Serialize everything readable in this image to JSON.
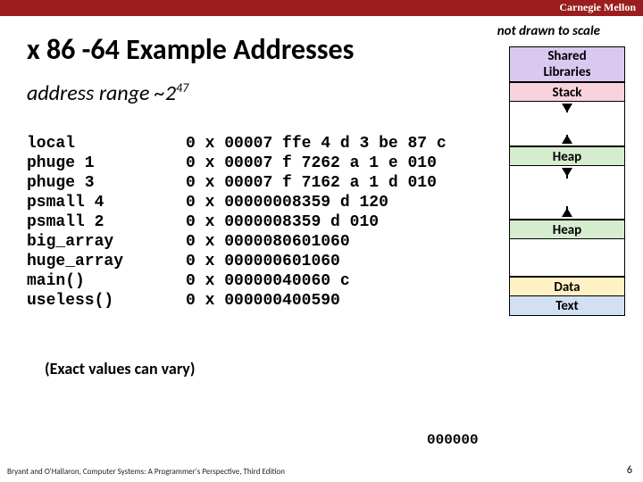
{
  "header": {
    "brand": "Carnegie Mellon"
  },
  "title": "x 86 -64 Example Addresses",
  "subtitle_prefix": "address range ~2",
  "subtitle_exp": "47",
  "scale_note": "not drawn to scale",
  "table": {
    "names": [
      "local",
      "phuge 1",
      "phuge 3",
      "psmall 4",
      "psmall 2",
      "big_array",
      "huge_array",
      "main()",
      "useless()"
    ],
    "addrs": [
      "0 x 00007 ffe 4 d 3 be 87 c",
      "0 x 00007 f 7262 a 1 e 010",
      "0 x 00007 f 7162 a 1 d 010",
      "0 x 00000008359 d 120",
      "0 x 0000008359 d 010",
      "0 x 0000080601060",
      "0 x 000000601060",
      "0 x 00000040060 c",
      "0 x 000000400590"
    ]
  },
  "memory": {
    "shared_l1": "Shared",
    "shared_l2": "Libraries",
    "stack": "Stack",
    "heap": "Heap",
    "heap2": "Heap",
    "data": "Data",
    "text": "Text"
  },
  "zero_label": "000000",
  "vary": "(Exact values can vary)",
  "footer": "Bryant and O'Hallaron, Computer Systems: A Programmer's Perspective, Third Edition",
  "page": "6"
}
